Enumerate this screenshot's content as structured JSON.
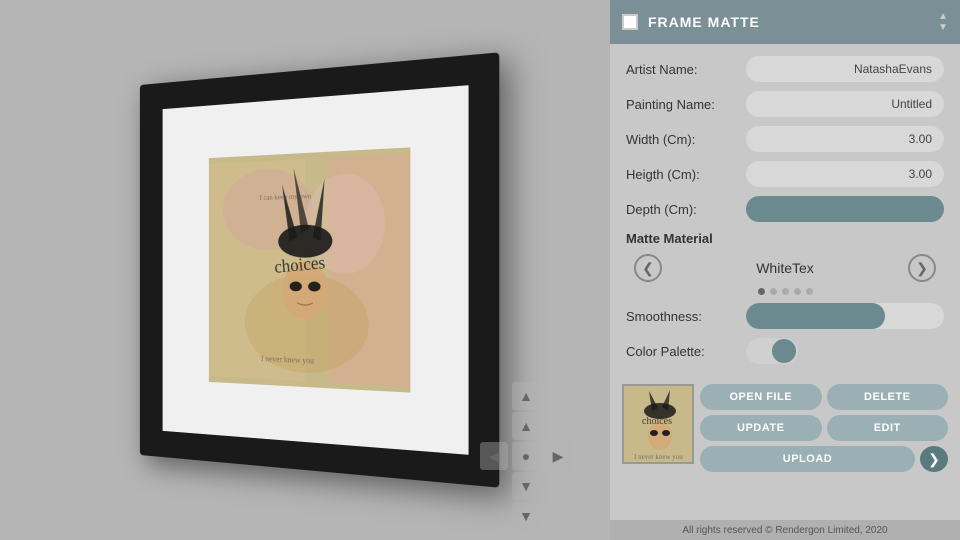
{
  "header": {
    "title": "FRAME MATTE",
    "checkbox_checked": false,
    "spinner_icon": "▲▼"
  },
  "form": {
    "artist_name_label": "Artist Name:",
    "artist_name_value": "NatashaEvans",
    "painting_name_label": "Painting Name:",
    "painting_name_value": "Untitled",
    "width_label": "Width (Cm):",
    "width_value": "3.00",
    "height_label": "Heigth (Cm):",
    "height_value": "3.00",
    "depth_label": "Depth (Cm):",
    "depth_value": ""
  },
  "matte": {
    "section_label": "Matte Material",
    "material_name": "WhiteTex",
    "prev_icon": "❮",
    "next_icon": "❯",
    "dots": [
      {
        "active": true
      },
      {
        "active": false
      },
      {
        "active": false
      },
      {
        "active": false
      },
      {
        "active": false
      }
    ]
  },
  "smoothness": {
    "label": "Smoothness:",
    "fill_percent": 70
  },
  "color_palette": {
    "label": "Color Palette:",
    "enabled": true
  },
  "buttons": {
    "open_file": "OPEN FILE",
    "delete": "DELETE",
    "update": "UPDATE",
    "edit": "EDIT",
    "upload": "UPLOAD",
    "next_icon": "❯"
  },
  "nav": {
    "up_icon": "▲",
    "down_icon": "▼",
    "left_icon": "◀",
    "right_icon": "▶",
    "center_icon": "●"
  },
  "footer": {
    "text": "All rights reserved © Rendergon Limited, 2020"
  }
}
